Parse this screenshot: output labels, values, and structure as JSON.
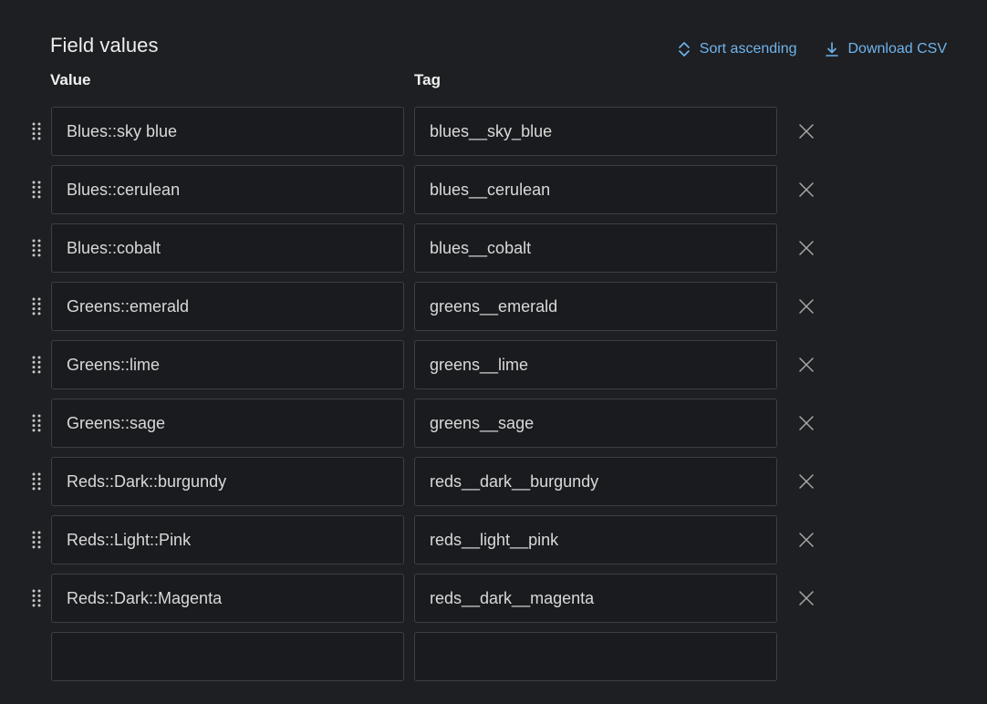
{
  "header": {
    "title": "Field values",
    "sort_label": "Sort ascending",
    "download_label": "Download CSV"
  },
  "columns": {
    "value": "Value",
    "tag": "Tag"
  },
  "rows": [
    {
      "value": "Blues::sky blue",
      "tag": "blues__sky_blue"
    },
    {
      "value": "Blues::cerulean",
      "tag": "blues__cerulean"
    },
    {
      "value": "Blues::cobalt",
      "tag": "blues__cobalt"
    },
    {
      "value": "Greens::emerald",
      "tag": "greens__emerald"
    },
    {
      "value": "Greens::lime",
      "tag": "greens__lime"
    },
    {
      "value": "Greens::sage",
      "tag": "greens__sage"
    },
    {
      "value": "Reds::Dark::burgundy",
      "tag": "reds__dark__burgundy"
    },
    {
      "value": "Reds::Light::Pink",
      "tag": "reds__light__pink"
    },
    {
      "value": "Reds::Dark::Magenta",
      "tag": "reds__dark__magenta"
    }
  ],
  "new_row": {
    "value": "",
    "tag": ""
  },
  "icons": {
    "sort": "chevron-up-down-icon",
    "download": "download-icon",
    "drag": "drag-handle-icon",
    "remove": "close-icon"
  },
  "colors": {
    "background": "#1e1f22",
    "accent": "#6fb4ec",
    "field_border": "#3d3f44"
  }
}
